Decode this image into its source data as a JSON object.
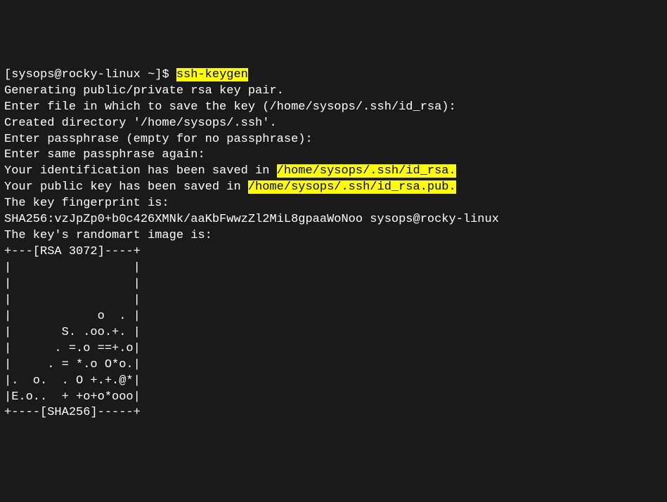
{
  "prompt": {
    "open_bracket": "[",
    "user_host": "sysops@rocky-linux ~",
    "close_bracket": "]",
    "dollar": "$ ",
    "command": "ssh-keygen"
  },
  "output": {
    "line1": "Generating public/private rsa key pair.",
    "line2": "Enter file in which to save the key (/home/sysops/.ssh/id_rsa):",
    "line3": "Created directory '/home/sysops/.ssh'.",
    "line4": "Enter passphrase (empty for no passphrase):",
    "line5": "Enter same passphrase again:",
    "line6_prefix": "Your identification has been saved in ",
    "line6_path": "/home/sysops/.ssh/id_rsa.",
    "line7_prefix": "Your public key has been saved in ",
    "line7_path": "/home/sysops/.ssh/id_rsa.pub.",
    "line8": "The key fingerprint is:",
    "line9": "SHA256:vzJpZp0+b0c426XMNk/aaKbFwwzZl2MiL8gpaaWoNoo sysops@rocky-linux",
    "line10": "The key's randomart image is:",
    "randomart": {
      "l1": "+---[RSA 3072]----+",
      "l2": "|                 |",
      "l3": "|                 |",
      "l4": "|                 |",
      "l5": "|            o  . |",
      "l6": "|       S. .oo.+. |",
      "l7": "|      . =.o ==+.o|",
      "l8": "|     . = *.o O*o.|",
      "l9": "|.  o.  . O +.+.@*|",
      "l10": "|E.o..  + +o+o*ooo|",
      "l11": "+----[SHA256]-----+"
    }
  }
}
